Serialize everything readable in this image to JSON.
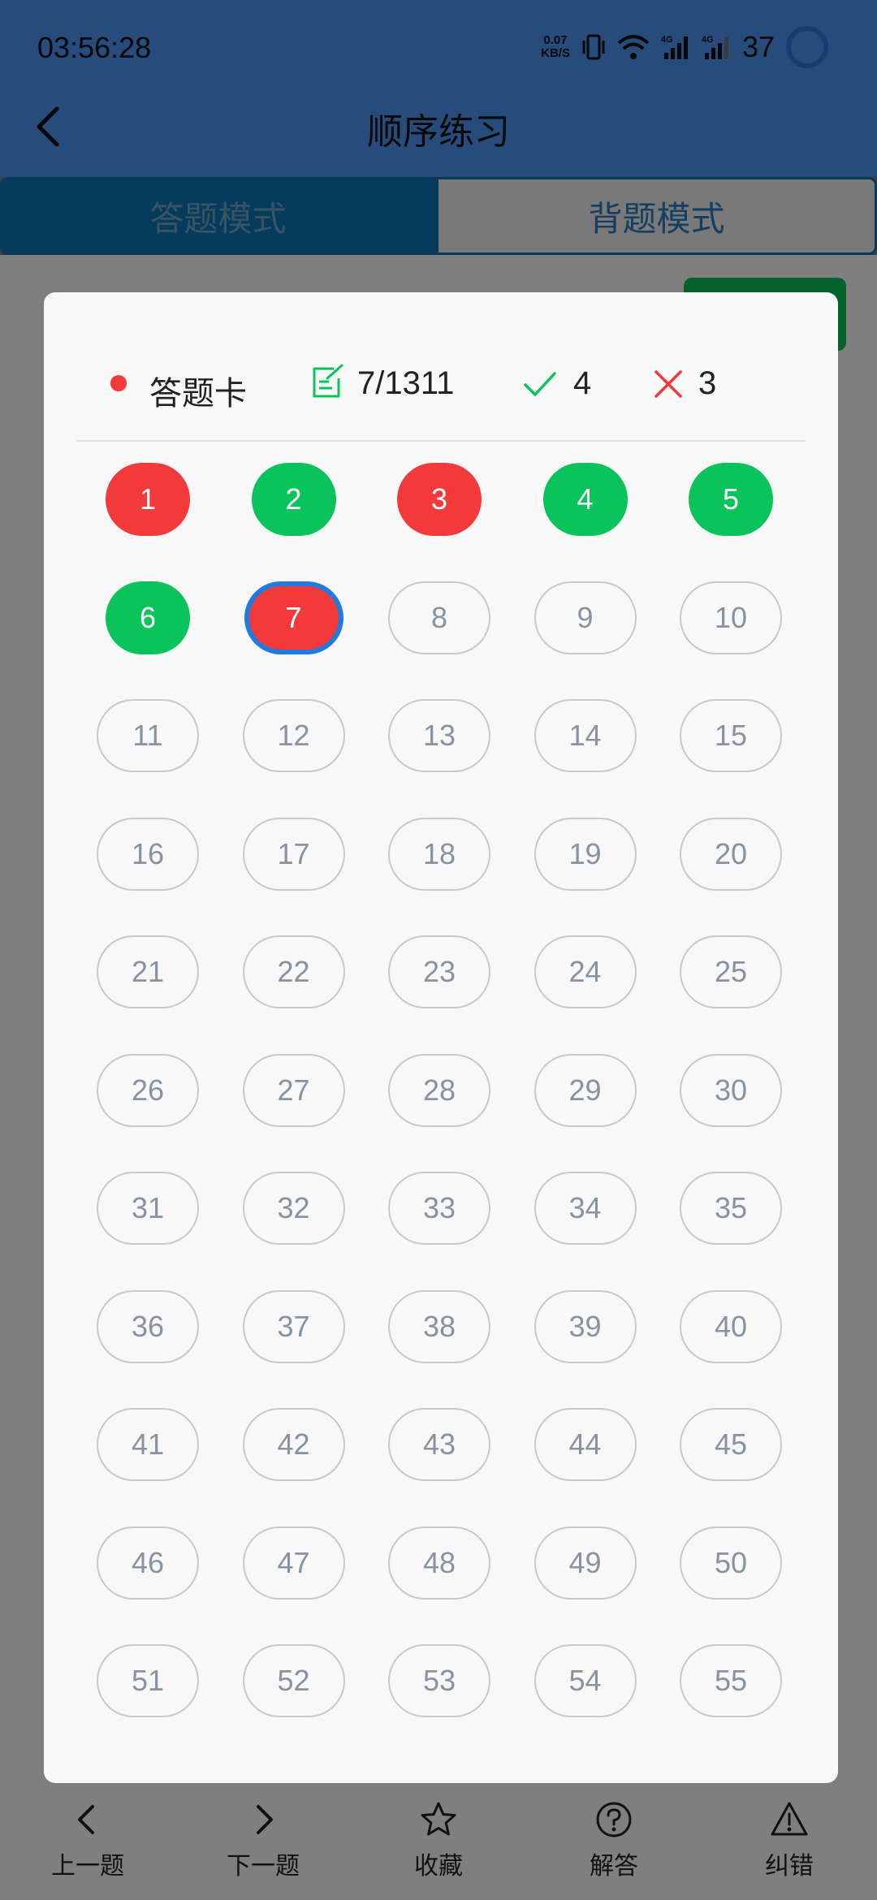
{
  "status_bar": {
    "time": "03:56:28",
    "net_speed_value": "0.07",
    "net_speed_unit": "KB/S",
    "battery": "37"
  },
  "header": {
    "title": "顺序练习"
  },
  "tabs": [
    {
      "label": "答题模式",
      "active": true
    },
    {
      "label": "背题模式",
      "active": false
    }
  ],
  "answer_card": {
    "title": "答题卡",
    "progress": "7/1311",
    "correct_count": "4",
    "wrong_count": "3",
    "current": 7,
    "cells": [
      {
        "n": "1",
        "state": "wrong"
      },
      {
        "n": "2",
        "state": "correct"
      },
      {
        "n": "3",
        "state": "wrong"
      },
      {
        "n": "4",
        "state": "correct"
      },
      {
        "n": "5",
        "state": "correct"
      },
      {
        "n": "6",
        "state": "correct"
      },
      {
        "n": "7",
        "state": "current"
      },
      {
        "n": "8",
        "state": "unanswered"
      },
      {
        "n": "9",
        "state": "unanswered"
      },
      {
        "n": "10",
        "state": "unanswered"
      },
      {
        "n": "11",
        "state": "unanswered"
      },
      {
        "n": "12",
        "state": "unanswered"
      },
      {
        "n": "13",
        "state": "unanswered"
      },
      {
        "n": "14",
        "state": "unanswered"
      },
      {
        "n": "15",
        "state": "unanswered"
      },
      {
        "n": "16",
        "state": "unanswered"
      },
      {
        "n": "17",
        "state": "unanswered"
      },
      {
        "n": "18",
        "state": "unanswered"
      },
      {
        "n": "19",
        "state": "unanswered"
      },
      {
        "n": "20",
        "state": "unanswered"
      },
      {
        "n": "21",
        "state": "unanswered"
      },
      {
        "n": "22",
        "state": "unanswered"
      },
      {
        "n": "23",
        "state": "unanswered"
      },
      {
        "n": "24",
        "state": "unanswered"
      },
      {
        "n": "25",
        "state": "unanswered"
      },
      {
        "n": "26",
        "state": "unanswered"
      },
      {
        "n": "27",
        "state": "unanswered"
      },
      {
        "n": "28",
        "state": "unanswered"
      },
      {
        "n": "29",
        "state": "unanswered"
      },
      {
        "n": "30",
        "state": "unanswered"
      },
      {
        "n": "31",
        "state": "unanswered"
      },
      {
        "n": "32",
        "state": "unanswered"
      },
      {
        "n": "33",
        "state": "unanswered"
      },
      {
        "n": "34",
        "state": "unanswered"
      },
      {
        "n": "35",
        "state": "unanswered"
      },
      {
        "n": "36",
        "state": "unanswered"
      },
      {
        "n": "37",
        "state": "unanswered"
      },
      {
        "n": "38",
        "state": "unanswered"
      },
      {
        "n": "39",
        "state": "unanswered"
      },
      {
        "n": "40",
        "state": "unanswered"
      },
      {
        "n": "41",
        "state": "unanswered"
      },
      {
        "n": "42",
        "state": "unanswered"
      },
      {
        "n": "43",
        "state": "unanswered"
      },
      {
        "n": "44",
        "state": "unanswered"
      },
      {
        "n": "45",
        "state": "unanswered"
      },
      {
        "n": "46",
        "state": "unanswered"
      },
      {
        "n": "47",
        "state": "unanswered"
      },
      {
        "n": "48",
        "state": "unanswered"
      },
      {
        "n": "49",
        "state": "unanswered"
      },
      {
        "n": "50",
        "state": "unanswered"
      },
      {
        "n": "51",
        "state": "unanswered"
      },
      {
        "n": "52",
        "state": "unanswered"
      },
      {
        "n": "53",
        "state": "unanswered"
      },
      {
        "n": "54",
        "state": "unanswered"
      },
      {
        "n": "55",
        "state": "unanswered"
      }
    ]
  },
  "bottom_nav": [
    {
      "label": "上一题",
      "icon": "chevron-left-icon"
    },
    {
      "label": "下一题",
      "icon": "chevron-right-icon"
    },
    {
      "label": "收藏",
      "icon": "star-icon"
    },
    {
      "label": "解答",
      "icon": "question-circle-icon"
    },
    {
      "label": "纠错",
      "icon": "warning-triangle-icon"
    }
  ],
  "colors": {
    "appbar": "#4f98f7",
    "correct": "#0ac45b",
    "wrong": "#f23a3a",
    "current_border": "#1f7be0"
  }
}
